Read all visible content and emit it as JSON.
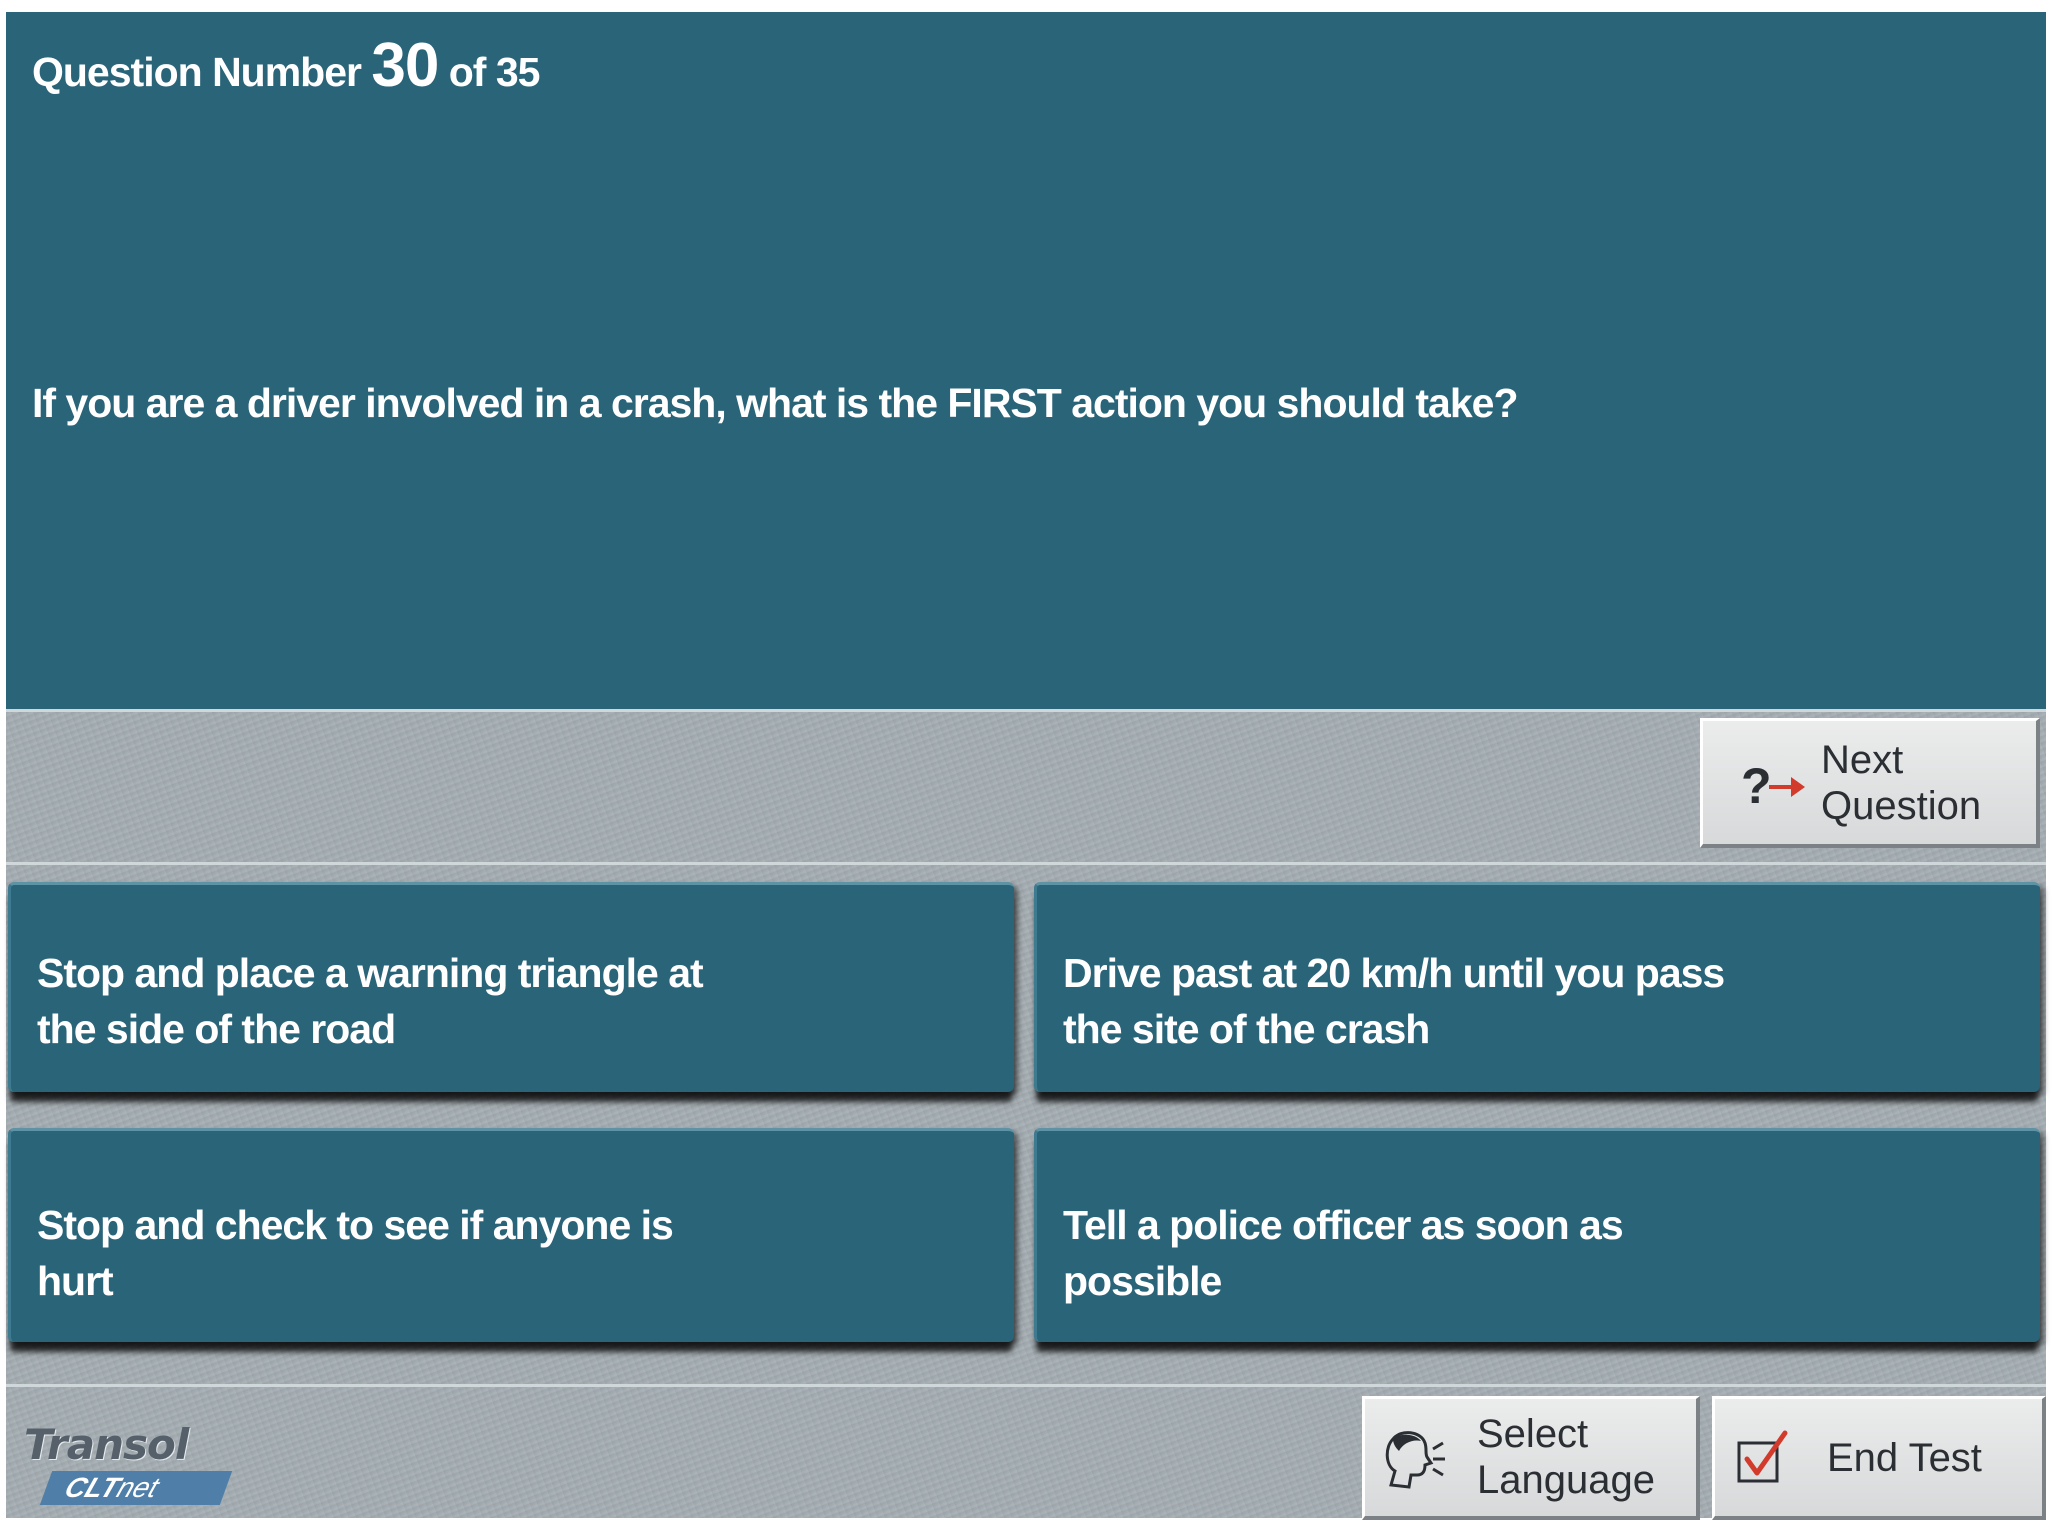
{
  "header": {
    "question_label": "Question Number",
    "question_current": "30",
    "question_of": "of 35"
  },
  "question": {
    "text": "If you are a driver involved in a crash, what is the FIRST action you should take?"
  },
  "answers": [
    {
      "line1": "Stop and place a warning triangle at",
      "line2": "the side of the road"
    },
    {
      "line1": "Drive past at 20 km/h until you pass",
      "line2": "the site of the crash"
    },
    {
      "line1": "Stop and check to see if anyone is",
      "line2": "hurt"
    },
    {
      "line1": "Tell a police officer as soon as",
      "line2": "possible"
    }
  ],
  "buttons": {
    "next_line1": "Next",
    "next_line2": "Question",
    "lang_line1": "Select",
    "lang_line2": "Language",
    "end": "End Test"
  },
  "logo": {
    "brand": "Transol",
    "product_bold": "CLT",
    "product_rest": "net"
  },
  "icons": {
    "next": "question-arrow-icon",
    "language": "speaking-head-icon",
    "end": "checkbox-check-icon"
  },
  "colors": {
    "panel": "#2a6479",
    "background": "#a4adb2",
    "arrow": "#d23a2c",
    "logo_bar": "#4f7fa8"
  }
}
